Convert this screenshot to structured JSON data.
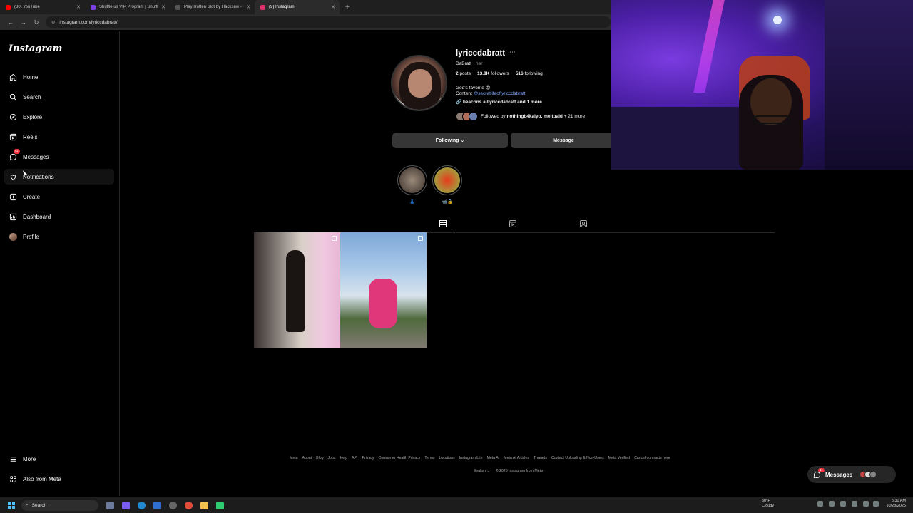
{
  "browser": {
    "tabs": [
      {
        "label": "(30) YouTube",
        "color": "#ff0000"
      },
      {
        "label": "Shuffle.us VIP Program | Shuffle",
        "color": "#7b3fe4"
      },
      {
        "label": "Play Rotten Slot by Hacksaw - S",
        "color": "#555555"
      },
      {
        "label": "(9) Instagram",
        "color": "#e1306c"
      }
    ],
    "url": "instagram.com/lyriccdabratt/"
  },
  "sidebar": {
    "logo": "Instagram",
    "items": [
      {
        "label": "Home",
        "icon": "home-icon"
      },
      {
        "label": "Search",
        "icon": "search-icon"
      },
      {
        "label": "Explore",
        "icon": "compass-icon"
      },
      {
        "label": "Reels",
        "icon": "reels-icon"
      },
      {
        "label": "Messages",
        "icon": "messenger-icon",
        "badge": "9+"
      },
      {
        "label": "Notifications",
        "icon": "heart-icon"
      },
      {
        "label": "Create",
        "icon": "plus-square-icon"
      },
      {
        "label": "Dashboard",
        "icon": "dashboard-icon"
      },
      {
        "label": "Profile",
        "icon": "avatar-icon"
      }
    ],
    "more": "More",
    "also_from_meta": "Also from Meta"
  },
  "profile": {
    "username": "lyriccdabratt",
    "name": "DaBratt",
    "pronoun": "her",
    "posts": "2",
    "posts_label": "posts",
    "followers": "13.8K",
    "followers_label": "followers",
    "following": "516",
    "following_label": "following",
    "bio_line1": "God's favorite 😍",
    "bio_line2_prefix": "Content",
    "bio_mention": "@secretlifeoflyriccdabratt",
    "link": "beacons.ai/lyriccdabratt and 1 more",
    "followed_by_prefix": "Followed by",
    "followed_by_names": "nothingb4kaiyo, meltpaid",
    "followed_by_suffix": "+ 21 more",
    "following_button": "Following ⌄",
    "message_button": "Message"
  },
  "highlights": [
    {
      "label": "👗",
      "color": "#6b5a4e"
    },
    {
      "label": "📹🔒",
      "color": "#c7331a"
    }
  ],
  "footer": {
    "links": [
      "Meta",
      "About",
      "Blog",
      "Jobs",
      "Help",
      "API",
      "Privacy",
      "Consumer Health Privacy",
      "Terms",
      "Locations",
      "Instagram Lite",
      "Meta AI",
      "Meta AI Articles",
      "Threads",
      "Contact Uploading & Non-Users",
      "Meta Verified",
      "Cancel contracts here"
    ],
    "language": "English ⌄",
    "copyright": "© 2025 Instagram from Meta"
  },
  "messages_pill": {
    "label": "Messages",
    "badge": "9+"
  },
  "taskbar": {
    "search": "Search",
    "weather_temp": "50°F",
    "weather_desc": "Cloudy",
    "time": "6:30 AM",
    "date": "10/28/2025"
  }
}
